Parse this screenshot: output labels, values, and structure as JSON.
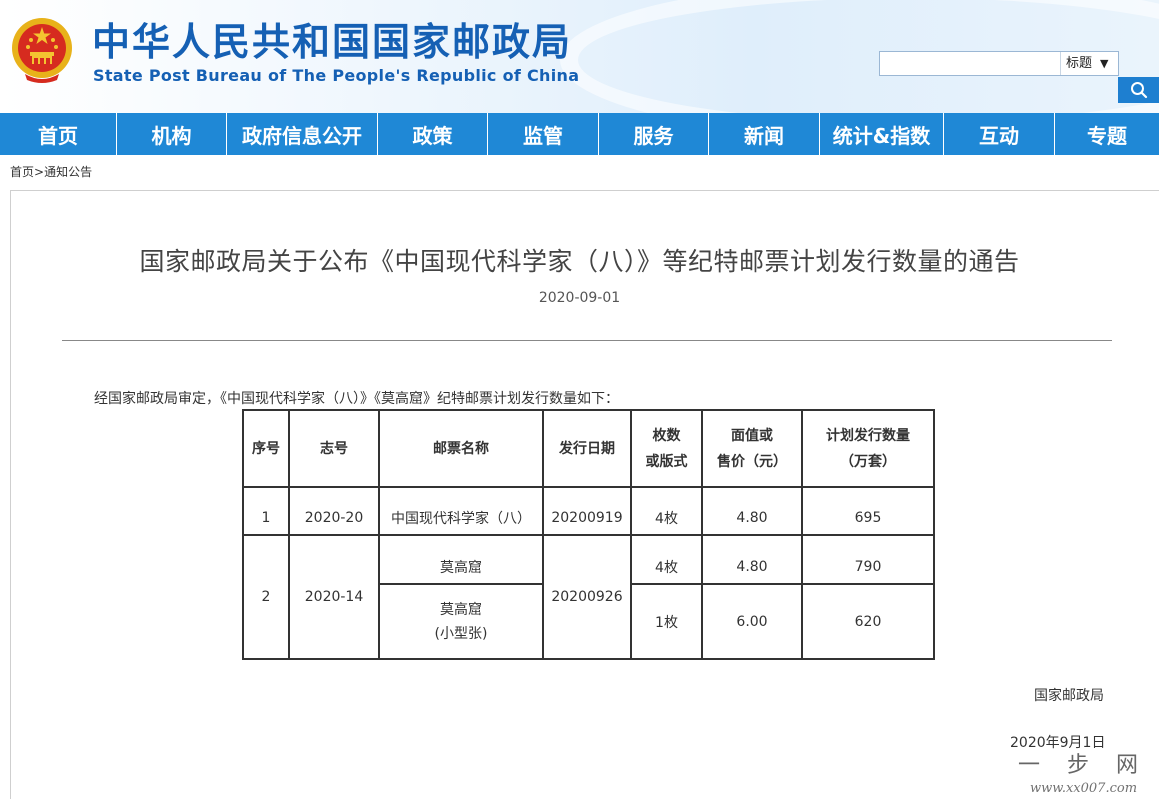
{
  "header": {
    "title": "中华人民共和国国家邮政局",
    "subtitle": "State Post Bureau of The People's Republic of China",
    "emblem_icon": "national-emblem-icon",
    "search": {
      "value": "",
      "placeholder": "",
      "select_value": "标题",
      "select_arrow": "▼",
      "button_icon": "search-icon"
    }
  },
  "colors": {
    "brand_blue": "#1560b4",
    "nav_blue": "#1f88d6",
    "search_button": "#1e7fd0"
  },
  "nav": {
    "items": [
      "首页",
      "机构",
      "政府信息公开",
      "政策",
      "监管",
      "服务",
      "新闻",
      "统计&指数",
      "互动",
      "专题"
    ]
  },
  "breadcrumb": {
    "home": "首页",
    "separator": ">",
    "current": "通知公告"
  },
  "article": {
    "title": "国家邮政局关于公布《中国现代科学家（八）》等纪特邮票计划发行数量的通告",
    "date": "2020-09-01",
    "intro": "经国家邮政局审定，《中国现代科学家（八）》《莫高窟》纪特邮票计划发行数量如下：",
    "table": {
      "headers": {
        "seq": "序号",
        "code": "志号",
        "name": "邮票名称",
        "issue_date": "发行日期",
        "count_line1": "枚数",
        "count_line2": "或版式",
        "price_line1": "面值或",
        "price_line2": "售价（元）",
        "qty_line1": "计划发行数量",
        "qty_line2": "（万套）"
      },
      "rows": [
        {
          "seq": "1",
          "code": "2020-20",
          "name": "中国现代科学家（八）",
          "issue_date": "20200919",
          "count": "4枚",
          "price": "4.80",
          "qty": "695"
        },
        {
          "seq": "2",
          "code": "2020-14",
          "issue_date": "20200926",
          "items": [
            {
              "name": "莫高窟",
              "name_note": "",
              "count": "4枚",
              "price": "4.80",
              "qty": "790"
            },
            {
              "name": "莫高窟",
              "name_note": "(小型张)",
              "count": "1枚",
              "price": "6.00",
              "qty": "620"
            }
          ]
        }
      ]
    },
    "signer": "国家邮政局",
    "sign_date": "2020年9月1日"
  },
  "watermark": {
    "icon": "site-watermark-logo",
    "text": "一 步 网",
    "url_text": "www.xx007.com"
  }
}
